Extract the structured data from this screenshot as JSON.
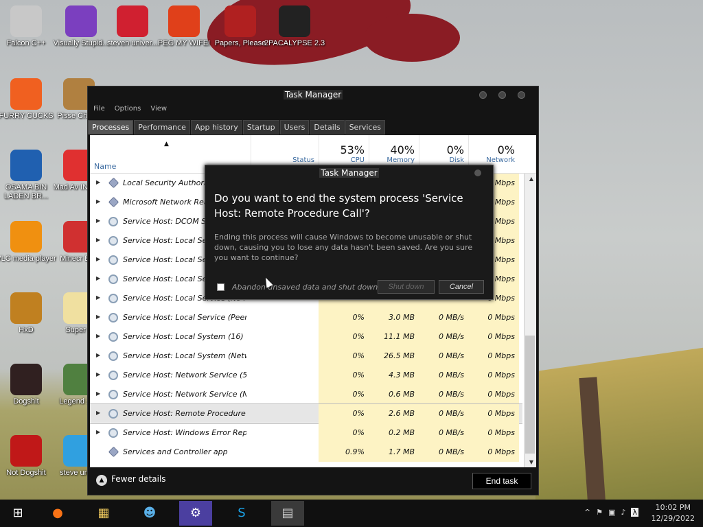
{
  "desktop": {
    "icons": [
      {
        "label": "Falcon C++",
        "icon": "recycle-bin-icon"
      },
      {
        "label": "Visually Stupid...",
        "icon": "visual-studio-icon"
      },
      {
        "label": "steven univer...",
        "icon": "steven-universe-icon"
      },
      {
        "label": "PEG MY WIFE!",
        "icon": "peggle-icon"
      },
      {
        "label": "Papers, Please",
        "icon": "papers-please-icon"
      },
      {
        "label": "2PACALYPSE 2.3",
        "icon": "terminal-icon"
      },
      {
        "label": "FURRY CUCKS",
        "icon": "firefox-icon"
      },
      {
        "label": "Pisse Chicke",
        "icon": "chicken-icon"
      },
      {
        "label": "OSAMA BIN LADEN BR...",
        "icon": "obama-logo-icon"
      },
      {
        "label": "Mad Av IN SPA",
        "icon": "angry-birds-space-icon"
      },
      {
        "label": "VLC media player",
        "icon": "vlc-icon"
      },
      {
        "label": "Minecr Bird",
        "icon": "angry-birds-icon"
      },
      {
        "label": "HxD",
        "icon": "hxd-icon"
      },
      {
        "label": "Super F",
        "icon": "super-icon"
      },
      {
        "label": "Dogshit",
        "icon": "codeblocks-icon"
      },
      {
        "label": "Legend Zild",
        "icon": "zelda-icon"
      },
      {
        "label": "Not Dogshit",
        "icon": "devcpp-icon"
      },
      {
        "label": "steve unive",
        "icon": "diamond-icon"
      }
    ]
  },
  "taskmanager": {
    "title": "Task Manager",
    "menu": [
      "File",
      "Options",
      "View"
    ],
    "tabs": [
      "Processes",
      "Performance",
      "App history",
      "Startup",
      "Users",
      "Details",
      "Services"
    ],
    "columns": {
      "name": "Name",
      "status": "Status",
      "cpu_pct": "53%",
      "cpu": "CPU",
      "mem_pct": "40%",
      "mem": "Memory",
      "disk_pct": "0%",
      "disk": "Disk",
      "net_pct": "0%",
      "net": "Network"
    },
    "rows": [
      {
        "name": "Local Security Authority",
        "cpu": "",
        "mem": "",
        "disk": "",
        "net": "0 Mbps",
        "type": "dia"
      },
      {
        "name": "Microsoft Network Realt",
        "cpu": "",
        "mem": "",
        "disk": "",
        "net": "0 Mbps",
        "type": "dia"
      },
      {
        "name": "Service Host: DCOM Ser",
        "cpu": "",
        "mem": "",
        "disk": "",
        "net": "0 Mbps",
        "type": "gear"
      },
      {
        "name": "Service Host: Local Serv",
        "cpu": "",
        "mem": "",
        "disk": "",
        "net": "0 Mbps",
        "type": "gear"
      },
      {
        "name": "Service Host: Local Serv",
        "cpu": "",
        "mem": "",
        "disk": "",
        "net": "0 Mbps",
        "type": "gear"
      },
      {
        "name": "Service Host: Local Serv",
        "cpu": "",
        "mem": "",
        "disk": "",
        "net": "0 Mbps",
        "type": "gear"
      },
      {
        "name": "Service Host: Local Service (No N...",
        "cpu": "",
        "mem": "",
        "disk": "",
        "net": "0 Mbps",
        "type": "gear"
      },
      {
        "name": "Service Host: Local Service (Peer ...",
        "cpu": "0%",
        "mem": "3.0 MB",
        "disk": "0 MB/s",
        "net": "0 Mbps",
        "type": "gear"
      },
      {
        "name": "Service Host: Local System (16)",
        "cpu": "0%",
        "mem": "11.1 MB",
        "disk": "0 MB/s",
        "net": "0 Mbps",
        "type": "gear"
      },
      {
        "name": "Service Host: Local System (Netw...",
        "cpu": "0%",
        "mem": "26.5 MB",
        "disk": "0 MB/s",
        "net": "0 Mbps",
        "type": "gear"
      },
      {
        "name": "Service Host: Network Service (5)",
        "cpu": "0%",
        "mem": "4.3 MB",
        "disk": "0 MB/s",
        "net": "0 Mbps",
        "type": "gear"
      },
      {
        "name": "Service Host: Network Service (N...",
        "cpu": "0%",
        "mem": "0.6 MB",
        "disk": "0 MB/s",
        "net": "0 Mbps",
        "type": "gear"
      },
      {
        "name": "Service Host: Remote Procedure C...",
        "cpu": "0%",
        "mem": "2.6 MB",
        "disk": "0 MB/s",
        "net": "0 Mbps",
        "type": "gear",
        "selected": true
      },
      {
        "name": "Service Host: Windows Error Repo...",
        "cpu": "0%",
        "mem": "0.2 MB",
        "disk": "0 MB/s",
        "net": "0 Mbps",
        "type": "gear"
      },
      {
        "name": "Services and Controller app",
        "cpu": "0.9%",
        "mem": "1.7 MB",
        "disk": "0 MB/s",
        "net": "0 Mbps",
        "type": "dia",
        "noarrow": true
      }
    ],
    "fewer_details": "Fewer details",
    "end_task": "End task"
  },
  "dialog": {
    "title": "Task Manager",
    "question": "Do you want to end the system process 'Service Host: Remote Procedure Call'?",
    "message": "Ending this process will cause Windows to become unusable or shut down, causing you to lose any data hasn't been saved. Are you sure you want to continue?",
    "checkbox_label": "Abandon unsaved data and shut down.",
    "shutdown_label": "Shut down",
    "cancel_label": "Cancel"
  },
  "taskbar": {
    "apps": [
      "windows-start-icon",
      "firefox-icon",
      "file-explorer-icon",
      "people-icon",
      "settings-icon",
      "skype-icon",
      "task-manager-icon"
    ],
    "time": "10:02 PM",
    "date": "12/29/2022"
  },
  "colors": {
    "heat": "#fdf3c4",
    "dialog_bg": "#1a1a1a",
    "window_bg": "#141414"
  }
}
